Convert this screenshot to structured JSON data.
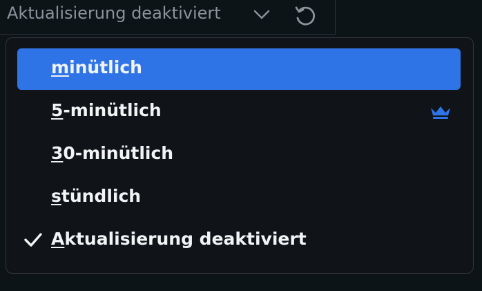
{
  "trigger": {
    "label": "Aktualisierung deaktiviert",
    "chevron_icon": "chevron-down-icon",
    "refresh_icon": "refresh-icon"
  },
  "menu": {
    "items": [
      {
        "mnemonic": "m",
        "rest": "inütlich",
        "selected": true,
        "checked": false,
        "premium": false
      },
      {
        "mnemonic": "5",
        "rest": "-minütlich",
        "selected": false,
        "checked": false,
        "premium": true
      },
      {
        "mnemonic": "3",
        "rest": "0-minütlich",
        "selected": false,
        "checked": false,
        "premium": false
      },
      {
        "mnemonic": "s",
        "rest": "tündlich",
        "selected": false,
        "checked": false,
        "premium": false
      },
      {
        "mnemonic": "A",
        "rest": "ktualisierung deaktiviert",
        "selected": false,
        "checked": true,
        "premium": false
      }
    ],
    "check_icon": "check-icon",
    "premium_icon": "crown-icon"
  },
  "colors": {
    "background": "#0d1418",
    "menu_background": "#101418",
    "selected": "#2f74e6",
    "crown": "#2f74e6",
    "text": "#f1f3f5",
    "muted_text": "#8b949b"
  }
}
